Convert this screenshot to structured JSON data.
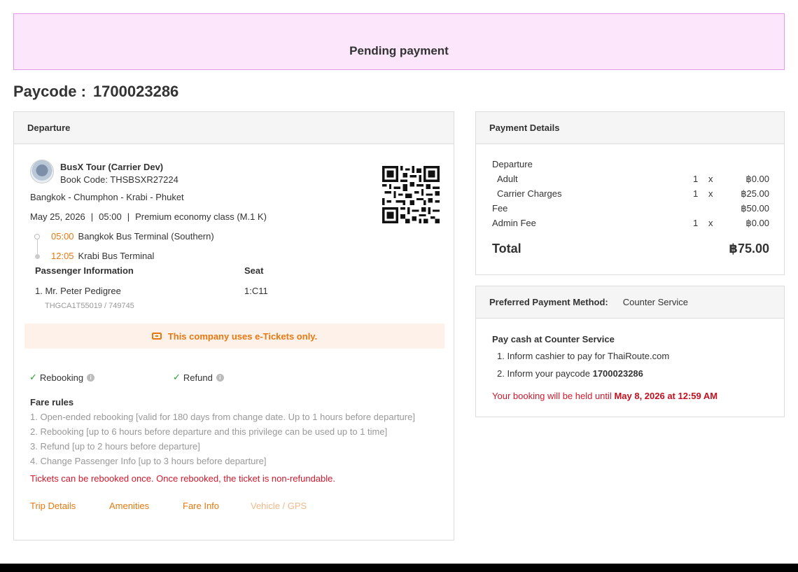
{
  "banner": {
    "status": "Pending payment"
  },
  "paycode": {
    "label": "Paycode :",
    "value": "1700023286"
  },
  "departure": {
    "header": "Departure",
    "carrier_name": "BusX Tour (Carrier Dev)",
    "book_code": "Book Code: THSBSXR27224",
    "route": "Bangkok - Chumphon - Krabi - Phuket",
    "date": "May 25, 2026",
    "time": "05:00",
    "class": "Premium economy class (M.1 K)",
    "separator": "|",
    "stops": [
      {
        "time": "05:00",
        "name": "Bangkok Bus Terminal (Southern)"
      },
      {
        "time": "12:05",
        "name": "Krabi Bus Terminal"
      }
    ],
    "passenger_header": "Passenger Information",
    "seat_header": "Seat",
    "passenger": {
      "name": "1. Mr. Peter Pedigree",
      "seat": "1:C11",
      "id": "THGCA1T55019 / 749745"
    },
    "eticket_notice": "This company uses e-Tickets only.",
    "features": [
      {
        "label": "Rebooking",
        "check": "✓",
        "info": "i"
      },
      {
        "label": "Refund",
        "check": "✓",
        "info": "i"
      }
    ],
    "fare_rules_title": "Fare rules",
    "fare_rules": [
      "1. Open-ended rebooking [valid for 180 days from change date. Up to 1 hours before departure]",
      "2. Rebooking [up to 6 hours before departure and this privilege can be used up to 1 time]",
      "3. Refund [up to 2 hours before departure]",
      "4. Change Passenger Info [up to 3 hours before departure]"
    ],
    "fare_warning": "Tickets can be rebooked once. Once rebooked, the ticket is non-refundable.",
    "links": [
      "Trip Details",
      "Amenities",
      "Fare Info",
      "Vehicle / GPS"
    ]
  },
  "payment": {
    "header": "Payment Details",
    "section": "Departure",
    "rows": [
      {
        "label": "Adult",
        "qty": "1",
        "x": "x",
        "amount": "฿0.00"
      },
      {
        "label": "Carrier Charges",
        "qty": "1",
        "x": "x",
        "amount": "฿25.00"
      },
      {
        "label": "Fee",
        "qty": "",
        "x": "",
        "amount": "฿50.00"
      },
      {
        "label": "Admin Fee",
        "qty": "1",
        "x": "x",
        "amount": "฿0.00"
      }
    ],
    "total_label": "Total",
    "total_amount": "฿75.00"
  },
  "method": {
    "label": "Preferred Payment Method:",
    "value": "Counter Service",
    "title": "Pay cash at Counter Service",
    "step1": "1. Inform cashier to pay for ThaiRoute.com",
    "step2_prefix": "2. Inform your paycode",
    "step2_code": "1700023286",
    "hold_prefix": "Your booking will be held until",
    "hold_date": "May 8, 2026 at 12:59 AM"
  },
  "colors": {
    "accent": "#e8780f",
    "danger": "#d0182b",
    "banner_bg": "#fbe6fc",
    "check": "#2a9d2a"
  }
}
